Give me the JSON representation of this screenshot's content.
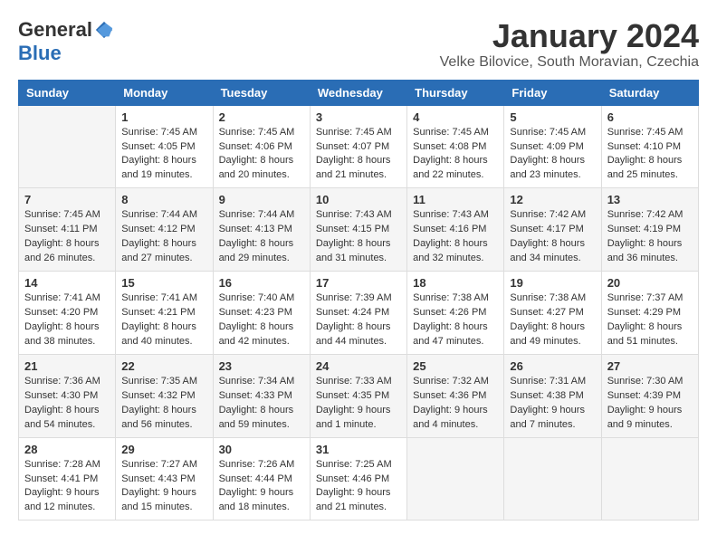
{
  "logo": {
    "general": "General",
    "blue": "Blue"
  },
  "title": "January 2024",
  "location": "Velke Bilovice, South Moravian, Czechia",
  "days_of_week": [
    "Sunday",
    "Monday",
    "Tuesday",
    "Wednesday",
    "Thursday",
    "Friday",
    "Saturday"
  ],
  "weeks": [
    [
      {
        "day": "",
        "sunrise": "",
        "sunset": "",
        "daylight": ""
      },
      {
        "day": "1",
        "sunrise": "Sunrise: 7:45 AM",
        "sunset": "Sunset: 4:05 PM",
        "daylight": "Daylight: 8 hours and 19 minutes."
      },
      {
        "day": "2",
        "sunrise": "Sunrise: 7:45 AM",
        "sunset": "Sunset: 4:06 PM",
        "daylight": "Daylight: 8 hours and 20 minutes."
      },
      {
        "day": "3",
        "sunrise": "Sunrise: 7:45 AM",
        "sunset": "Sunset: 4:07 PM",
        "daylight": "Daylight: 8 hours and 21 minutes."
      },
      {
        "day": "4",
        "sunrise": "Sunrise: 7:45 AM",
        "sunset": "Sunset: 4:08 PM",
        "daylight": "Daylight: 8 hours and 22 minutes."
      },
      {
        "day": "5",
        "sunrise": "Sunrise: 7:45 AM",
        "sunset": "Sunset: 4:09 PM",
        "daylight": "Daylight: 8 hours and 23 minutes."
      },
      {
        "day": "6",
        "sunrise": "Sunrise: 7:45 AM",
        "sunset": "Sunset: 4:10 PM",
        "daylight": "Daylight: 8 hours and 25 minutes."
      }
    ],
    [
      {
        "day": "7",
        "sunrise": "Sunrise: 7:45 AM",
        "sunset": "Sunset: 4:11 PM",
        "daylight": "Daylight: 8 hours and 26 minutes."
      },
      {
        "day": "8",
        "sunrise": "Sunrise: 7:44 AM",
        "sunset": "Sunset: 4:12 PM",
        "daylight": "Daylight: 8 hours and 27 minutes."
      },
      {
        "day": "9",
        "sunrise": "Sunrise: 7:44 AM",
        "sunset": "Sunset: 4:13 PM",
        "daylight": "Daylight: 8 hours and 29 minutes."
      },
      {
        "day": "10",
        "sunrise": "Sunrise: 7:43 AM",
        "sunset": "Sunset: 4:15 PM",
        "daylight": "Daylight: 8 hours and 31 minutes."
      },
      {
        "day": "11",
        "sunrise": "Sunrise: 7:43 AM",
        "sunset": "Sunset: 4:16 PM",
        "daylight": "Daylight: 8 hours and 32 minutes."
      },
      {
        "day": "12",
        "sunrise": "Sunrise: 7:42 AM",
        "sunset": "Sunset: 4:17 PM",
        "daylight": "Daylight: 8 hours and 34 minutes."
      },
      {
        "day": "13",
        "sunrise": "Sunrise: 7:42 AM",
        "sunset": "Sunset: 4:19 PM",
        "daylight": "Daylight: 8 hours and 36 minutes."
      }
    ],
    [
      {
        "day": "14",
        "sunrise": "Sunrise: 7:41 AM",
        "sunset": "Sunset: 4:20 PM",
        "daylight": "Daylight: 8 hours and 38 minutes."
      },
      {
        "day": "15",
        "sunrise": "Sunrise: 7:41 AM",
        "sunset": "Sunset: 4:21 PM",
        "daylight": "Daylight: 8 hours and 40 minutes."
      },
      {
        "day": "16",
        "sunrise": "Sunrise: 7:40 AM",
        "sunset": "Sunset: 4:23 PM",
        "daylight": "Daylight: 8 hours and 42 minutes."
      },
      {
        "day": "17",
        "sunrise": "Sunrise: 7:39 AM",
        "sunset": "Sunset: 4:24 PM",
        "daylight": "Daylight: 8 hours and 44 minutes."
      },
      {
        "day": "18",
        "sunrise": "Sunrise: 7:38 AM",
        "sunset": "Sunset: 4:26 PM",
        "daylight": "Daylight: 8 hours and 47 minutes."
      },
      {
        "day": "19",
        "sunrise": "Sunrise: 7:38 AM",
        "sunset": "Sunset: 4:27 PM",
        "daylight": "Daylight: 8 hours and 49 minutes."
      },
      {
        "day": "20",
        "sunrise": "Sunrise: 7:37 AM",
        "sunset": "Sunset: 4:29 PM",
        "daylight": "Daylight: 8 hours and 51 minutes."
      }
    ],
    [
      {
        "day": "21",
        "sunrise": "Sunrise: 7:36 AM",
        "sunset": "Sunset: 4:30 PM",
        "daylight": "Daylight: 8 hours and 54 minutes."
      },
      {
        "day": "22",
        "sunrise": "Sunrise: 7:35 AM",
        "sunset": "Sunset: 4:32 PM",
        "daylight": "Daylight: 8 hours and 56 minutes."
      },
      {
        "day": "23",
        "sunrise": "Sunrise: 7:34 AM",
        "sunset": "Sunset: 4:33 PM",
        "daylight": "Daylight: 8 hours and 59 minutes."
      },
      {
        "day": "24",
        "sunrise": "Sunrise: 7:33 AM",
        "sunset": "Sunset: 4:35 PM",
        "daylight": "Daylight: 9 hours and 1 minute."
      },
      {
        "day": "25",
        "sunrise": "Sunrise: 7:32 AM",
        "sunset": "Sunset: 4:36 PM",
        "daylight": "Daylight: 9 hours and 4 minutes."
      },
      {
        "day": "26",
        "sunrise": "Sunrise: 7:31 AM",
        "sunset": "Sunset: 4:38 PM",
        "daylight": "Daylight: 9 hours and 7 minutes."
      },
      {
        "day": "27",
        "sunrise": "Sunrise: 7:30 AM",
        "sunset": "Sunset: 4:39 PM",
        "daylight": "Daylight: 9 hours and 9 minutes."
      }
    ],
    [
      {
        "day": "28",
        "sunrise": "Sunrise: 7:28 AM",
        "sunset": "Sunset: 4:41 PM",
        "daylight": "Daylight: 9 hours and 12 minutes."
      },
      {
        "day": "29",
        "sunrise": "Sunrise: 7:27 AM",
        "sunset": "Sunset: 4:43 PM",
        "daylight": "Daylight: 9 hours and 15 minutes."
      },
      {
        "day": "30",
        "sunrise": "Sunrise: 7:26 AM",
        "sunset": "Sunset: 4:44 PM",
        "daylight": "Daylight: 9 hours and 18 minutes."
      },
      {
        "day": "31",
        "sunrise": "Sunrise: 7:25 AM",
        "sunset": "Sunset: 4:46 PM",
        "daylight": "Daylight: 9 hours and 21 minutes."
      },
      {
        "day": "",
        "sunrise": "",
        "sunset": "",
        "daylight": ""
      },
      {
        "day": "",
        "sunrise": "",
        "sunset": "",
        "daylight": ""
      },
      {
        "day": "",
        "sunrise": "",
        "sunset": "",
        "daylight": ""
      }
    ]
  ]
}
